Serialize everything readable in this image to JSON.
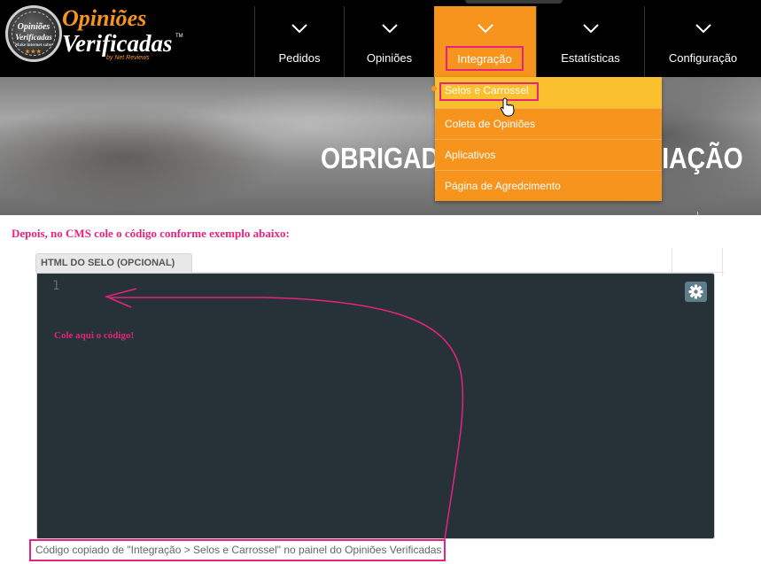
{
  "logo": {
    "badge_line1": "Opiniões",
    "badge_line2": "Verificadas",
    "badge_line3": "Make internet safer",
    "badge_stars": "★★★",
    "word1": "Opiniões",
    "word2": "Verificadas",
    "tm": "TM",
    "by": "by Net Reviews"
  },
  "nav": {
    "items": [
      {
        "label": "Pedidos"
      },
      {
        "label": "Opiniões"
      },
      {
        "label": "Integração"
      },
      {
        "label": "Estatísticas"
      },
      {
        "label": "Configuração"
      }
    ],
    "active_index": 2
  },
  "banner": {
    "title": "OBRIGADO PELA SUA AVALIAÇÃO"
  },
  "dropdown": {
    "items": [
      {
        "label": "Selos e Carrossel"
      },
      {
        "label": "Coleta de Opiniões"
      },
      {
        "label": "Aplicativos"
      },
      {
        "label": "Página de Agredcimento"
      }
    ]
  },
  "instruction": "Depois, no CMS cole o código conforme exemplo abaixo:",
  "editor": {
    "tab_label": "HTML DO SELO (OPCIONAL)",
    "line_number": "1",
    "paste_note": "Cole aqui o código!"
  },
  "caption": "Código copiado de \"Integração > Selos e Carrossel\" no painel do Opiniões Verificadas",
  "colors": {
    "accent_orange": "#f7941d",
    "highlight_pink": "#e6237f",
    "dropdown_hover": "#fbc02d",
    "editor_bg": "#263238"
  }
}
